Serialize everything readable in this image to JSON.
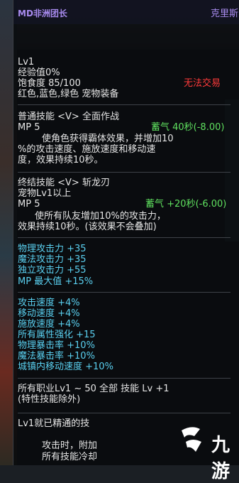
{
  "header": {
    "item_name": "MD非洲团长",
    "character": "克里斯"
  },
  "item": {
    "level": "Lv1",
    "exp": "经验值0%",
    "satiety": "饱食度 85/100",
    "slots": "红色,蓝色,绿色 宠物装备",
    "trade": "无法交易"
  },
  "skill1": {
    "title": "普通技能 <V> 全面作战",
    "mp": "MP 5",
    "charge": "蓄气 40秒(-8.00)",
    "desc": [
      "使角色获得霸体效果，并增加10",
      "%的攻击速度、施放速度和移动速",
      "度，效果持续10秒。"
    ]
  },
  "skill2": {
    "title": "终结技能 <V> 斩龙刃",
    "req": "宠物Lv1以上",
    "mp": "MP 5",
    "charge": "蓄气 +20秒(-6.00)",
    "desc": [
      "使所有队友增加10%的攻击力，",
      "效果持续10秒。(该效果不会叠加)"
    ]
  },
  "stats1": [
    "物理攻击力 +35",
    "魔法攻击力 +35",
    "独立攻击力 +55",
    "MP 最大值 +15%"
  ],
  "stats2": [
    "攻击速度 +4%",
    "移动速度 +4%",
    "施放速度 +4%",
    "所有属性强化 +15",
    "物理暴击率 +10%",
    "魔法暴击率 +10%",
    "城镇内移动速度 +10%"
  ],
  "skill_bonus": [
    "所有职业Lv1 ~ 50 全部 技能 Lv +1",
    "(特性技能除外)"
  ],
  "passive": [
    "Lv1就已精通的技",
    "攻击时，附加",
    "所有技能冷却"
  ],
  "watermark": "九游",
  "colors": {
    "purple": "#a98cf0",
    "green": "#5fe05f",
    "blue": "#5ad0f0",
    "red": "#ff3a3a"
  }
}
